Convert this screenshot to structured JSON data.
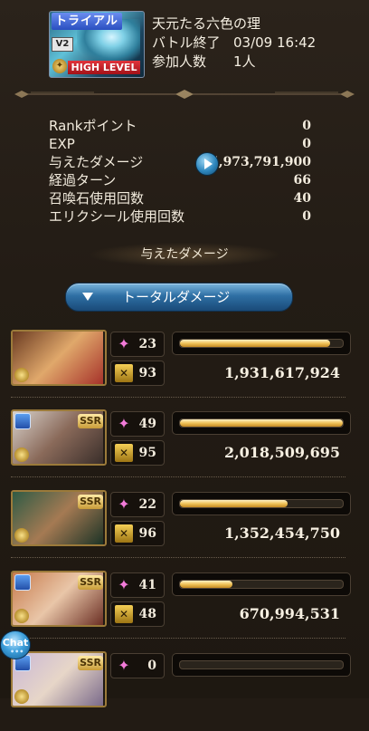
{
  "quest": {
    "thumbnail": {
      "trial_tag": "トライアル",
      "version_tag": "V2",
      "level_tag": "HIGH LEVEL"
    },
    "name": "天元たる六色の理",
    "status_label": "バトル終了",
    "status_time": "03/09 16:42",
    "participants_label": "参加人数",
    "participants_value": "1人"
  },
  "stats": [
    {
      "label": "Rankポイント",
      "value": "0"
    },
    {
      "label": "EXP",
      "value": "0"
    },
    {
      "label": "与えたダメージ",
      "value": "5,973,791,900"
    },
    {
      "label": "経過ターン",
      "value": "66"
    },
    {
      "label": "召喚石使用回数",
      "value": "40"
    },
    {
      "label": "エリクシール使用回数",
      "value": "0"
    }
  ],
  "damage_section": {
    "title": "与えたダメージ",
    "dropdown_label": "トータルダメージ"
  },
  "characters": [
    {
      "name": "main-character",
      "stat1": "23",
      "stat2": "93",
      "damage": "1,931,617,924",
      "bar_fill": 0.92,
      "rarity": "",
      "element": "none",
      "colors": [
        "#6b3b22",
        "#e0a86b",
        "#a6322a"
      ]
    },
    {
      "name": "character-2",
      "stat1": "49",
      "stat2": "95",
      "damage": "2,018,509,695",
      "bar_fill": 1.0,
      "rarity": "SSR",
      "element": "water",
      "colors": [
        "#d8d2cc",
        "#8a6a5a",
        "#3a2e2a"
      ]
    },
    {
      "name": "character-3",
      "stat1": "22",
      "stat2": "96",
      "damage": "1,352,454,750",
      "bar_fill": 0.66,
      "rarity": "SSR",
      "element": "none",
      "colors": [
        "#2f5b45",
        "#a57a53",
        "#1c3326"
      ]
    },
    {
      "name": "character-4",
      "stat1": "41",
      "stat2": "48",
      "damage": "670,994,531",
      "bar_fill": 0.32,
      "rarity": "SSR",
      "element": "water",
      "colors": [
        "#c77a4c",
        "#e9c6a8",
        "#6b2f24"
      ]
    },
    {
      "name": "character-5",
      "stat1": "0",
      "stat2": "",
      "damage": "",
      "bar_fill": 0.0,
      "rarity": "SSR",
      "element": "water",
      "colors": [
        "#c9b7d6",
        "#e7d6c8",
        "#7a6a8a"
      ]
    }
  ],
  "chat": {
    "label": "Chat",
    "dots": "•••"
  },
  "colors": {
    "bar_fill": "#f0c35a",
    "button_blue": "#2e6fa4",
    "background": "#221b14"
  }
}
